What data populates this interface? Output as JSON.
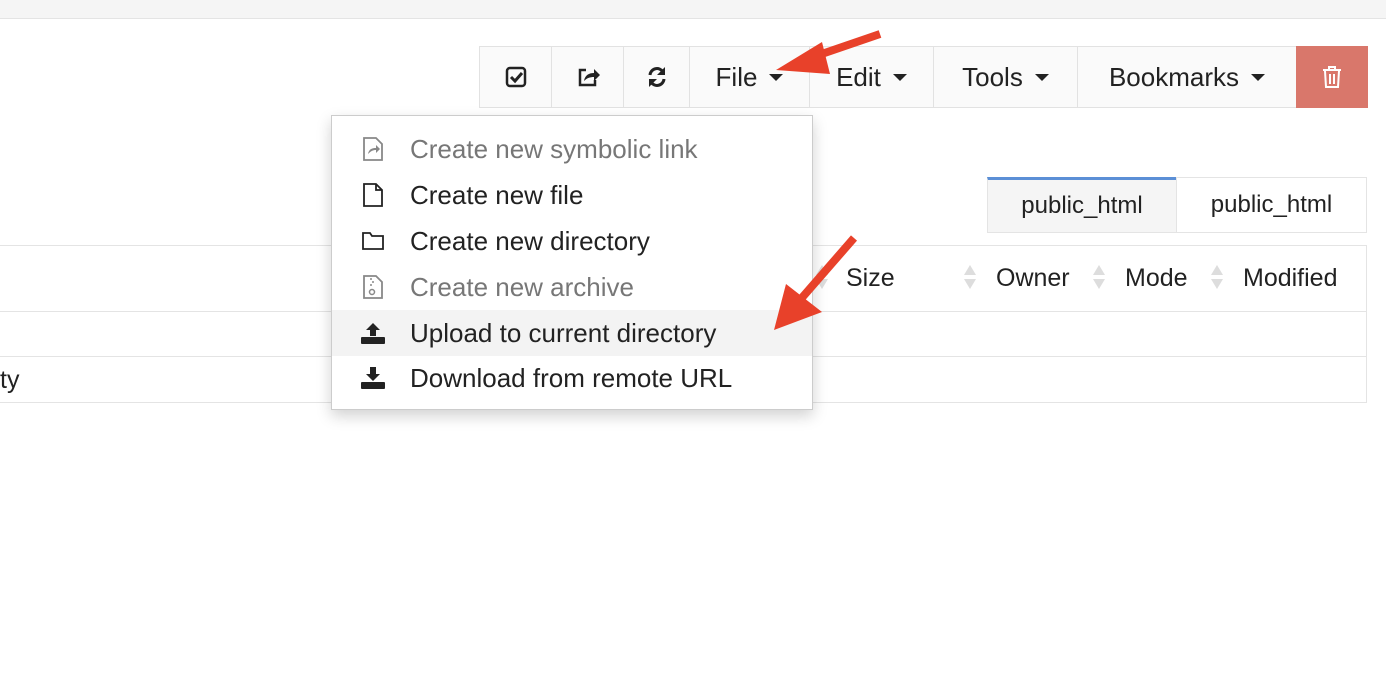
{
  "toolbar": {
    "buttons": [
      {
        "icon": "check-square-icon"
      },
      {
        "icon": "share-icon"
      },
      {
        "icon": "refresh-icon"
      },
      {
        "label": "File"
      },
      {
        "label": "Edit"
      },
      {
        "label": "Tools"
      },
      {
        "label": "Bookmarks"
      },
      {
        "icon": "trash-icon",
        "color": "#d9776b"
      }
    ]
  },
  "file_menu": {
    "items": [
      {
        "label": "Create new symbolic link",
        "icon": "symlink-file-icon",
        "disabled": true
      },
      {
        "label": "Create new file",
        "icon": "file-icon",
        "disabled": false
      },
      {
        "label": "Create new directory",
        "icon": "folder-icon",
        "disabled": false
      },
      {
        "label": "Create new archive",
        "icon": "archive-file-icon",
        "disabled": true
      },
      {
        "label": "Upload to current directory",
        "icon": "upload-icon",
        "disabled": false,
        "highlighted": true
      },
      {
        "label": "Download from remote URL",
        "icon": "download-icon",
        "disabled": false
      }
    ]
  },
  "path_tabs": [
    {
      "label": "public_html",
      "active": true
    },
    {
      "label": "public_html",
      "active": false
    }
  ],
  "table": {
    "columns": [
      "Size",
      "Owner",
      "Mode",
      "Modified"
    ],
    "rows": [
      {
        "name": ""
      },
      {
        "name": "ty"
      }
    ]
  },
  "annotations": {
    "arrow_color": "#e8412a"
  },
  "colors": {
    "active_tab_border": "#5b8fd6",
    "delete_button": "#d9776b"
  }
}
